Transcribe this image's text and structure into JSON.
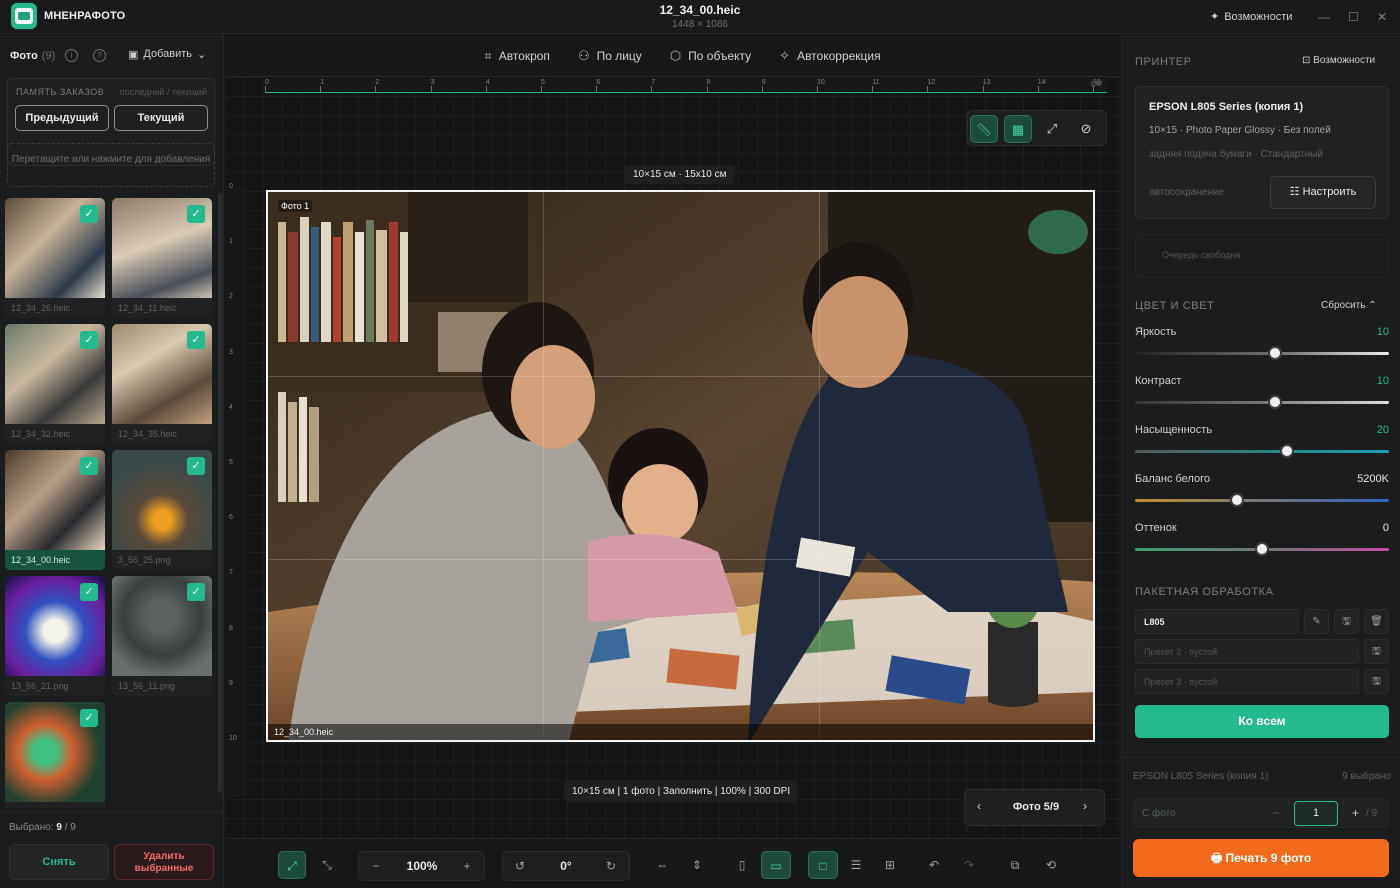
{
  "app": {
    "name": "МНЕНРАФОТО",
    "file": "12_34_00.heic",
    "dims": "1448 × 1086",
    "features": "Возможности"
  },
  "left": {
    "photos_label": "Фото",
    "photos_count": "(9)",
    "add_label": "Добавить",
    "memory_title": "ПАМЯТЬ ЗАКАЗОВ",
    "memory_hint": "последний / текущий",
    "prev": "Предыдущий",
    "current": "Текущий",
    "drop_text": "Перетащите или нажмите для добавления",
    "thumbs": [
      "12_34_26.heic",
      "12_34_11.heic",
      "12_34_32.heic",
      "12_34_35.heic",
      "12_34_00.heic",
      "3_56_25.png",
      "13_56_21.png",
      "13_56_11.png",
      ""
    ],
    "selected_label": "Выбрано:",
    "selected_value": "9",
    "selected_total": "/ 9",
    "unselect": "Снять",
    "delete_selected": "Удалить выбранные"
  },
  "center": {
    "tools": [
      "Автокроп",
      "По лицу",
      "По объекту",
      "Автокоррекция"
    ],
    "ruler_h": [
      "0",
      "1",
      "2",
      "3",
      "4",
      "5",
      "6",
      "7",
      "8",
      "9",
      "10",
      "11",
      "12",
      "13",
      "14",
      "15"
    ],
    "ruler_unit": "СМ",
    "ruler_v": [
      "0",
      "1",
      "2",
      "3",
      "4",
      "5",
      "6",
      "7",
      "8",
      "9",
      "10"
    ],
    "size_tag": "10×15 см · 15х10 см",
    "photo_label": "Фото 1",
    "photo_file": "12_34_00.heic",
    "info_bar": "10×15 см | 1 фото | Заполнить | 100% | 300 DPI",
    "page": "Фото 5/9",
    "zoom": "100%",
    "rotation": "0°"
  },
  "right": {
    "printer_title": "ПРИНТЕР",
    "features": "Возможности",
    "printer_name": "EPSON L805 Series (копия 1)",
    "paper": "10×15 · Photo Paper Glossy · Без полей",
    "feed": "задняя подача бумаги · Стандартный",
    "autosave": "автосохранение",
    "configure": "Настроить",
    "queue": "Очередь свободна",
    "color_title": "ЦВЕТ И СВЕТ",
    "reset": "Сбросить",
    "sliders": [
      {
        "label": "Яркость",
        "value": "10",
        "level": 0.55
      },
      {
        "label": "Контраст",
        "value": "10",
        "level": 0.55
      },
      {
        "label": "Насыщенность",
        "value": "20",
        "level": 0.6
      },
      {
        "label": "Баланс белого",
        "value": "5200K",
        "level": 0.4
      },
      {
        "label": "Оттенок",
        "value": "0",
        "level": 0.5
      }
    ],
    "batch_title": "ПАКЕТНАЯ ОБРАБОТКА",
    "presets": [
      "L805",
      "Пресет 2 · пустой",
      "Пресет 3 · пустой"
    ],
    "apply_all": "Ко всем",
    "footer_printer": "EPSON L805 Series (копия 1)",
    "footer_selected": "9 выбрано",
    "copies_label": "С фото",
    "copies_value": "1",
    "copies_total": "/ 9",
    "print": "Печать 9 фото"
  }
}
